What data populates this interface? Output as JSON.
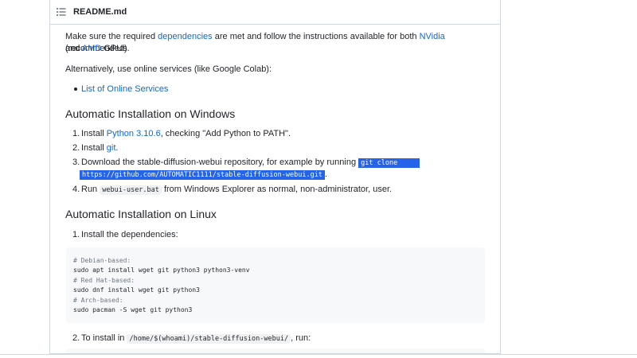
{
  "header": {
    "title": "README.md",
    "toc_icon": "list-icon"
  },
  "intro": {
    "line1_prefix": "Make sure the required ",
    "line1_link_deps": "dependencies",
    "line1_middle": " are met and follow the instructions available for both ",
    "line1_link_nvidia": "NVidia",
    "line1_suffix": " (recommended)",
    "line2_prefix": "and ",
    "line2_link_amd": "AMD",
    "line2_suffix": " GPUs."
  },
  "alternatively": "Alternatively, use online services (like Google Colab):",
  "online_services_link": "List of Online Services",
  "windows": {
    "heading": "Automatic Installation on Windows",
    "step1_prefix": "Install ",
    "step1_link": "Python 3.10.6",
    "step1_suffix": ", checking \"Add Python to PATH\".",
    "step2_prefix": "Install ",
    "step2_link": "git",
    "step2_suffix": ".",
    "step3_prefix": "Download the stable-diffusion-webui repository, for example by running ",
    "step3_code_part1": "git clone ",
    "step3_code_part2": "https://github.com/AUTOMATIC1111/stable-diffusion-webui.git",
    "step3_suffix": ".",
    "step4_prefix": "Run ",
    "step4_code": "webui-user.bat",
    "step4_suffix": " from Windows Explorer as normal, non-administrator, user."
  },
  "linux": {
    "heading": "Automatic Installation on Linux",
    "step1": "Install the dependencies:",
    "code_lines": [
      "# Debian-based:",
      "sudo apt install wget git python3 python3-venv",
      "# Red Hat-based:",
      "sudo dnf install wget git python3",
      "# Arch-based:",
      "sudo pacman -S wget git python3"
    ],
    "step2_prefix": "To install in ",
    "step2_code": "/home/$(whoami)/stable-diffusion-webui/",
    "step2_suffix": ", run:"
  },
  "list_numbers": [
    "1.",
    "2.",
    "3.",
    "4."
  ],
  "colors": {
    "link": "#0969da",
    "selection": "#2563eb",
    "code_bg": "#f6f8fa",
    "border": "#d0d7de"
  }
}
